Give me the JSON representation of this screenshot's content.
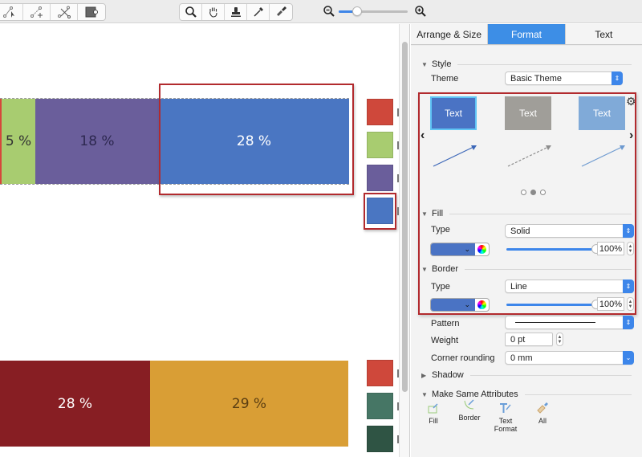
{
  "toolbar": {
    "left_tools": [
      {
        "icon": "select-path-icon",
        "label": "Select path"
      },
      {
        "icon": "add-point-icon",
        "label": "Add point"
      },
      {
        "icon": "scissors-path-icon",
        "label": "Cut path"
      },
      {
        "icon": "insert-shape-icon",
        "label": "Insert shape"
      }
    ],
    "center_tools": [
      {
        "icon": "magnifier-icon",
        "label": "Zoom"
      },
      {
        "icon": "hand-icon",
        "label": "Pan"
      },
      {
        "icon": "stamp-icon",
        "label": "Stamp"
      },
      {
        "icon": "eyedropper-icon",
        "label": "Eyedropper"
      },
      {
        "icon": "paint-brush-icon",
        "label": "Format painter"
      }
    ],
    "zoom_level_fraction": 0.27
  },
  "canvas": {
    "row1": [
      {
        "label": "",
        "color": "#d6473b",
        "share": 0.5
      },
      {
        "label": "5 %",
        "color": "#a8cc70",
        "share": 5,
        "text_color": "#333"
      },
      {
        "label": "18 %",
        "color": "#6a5e9b",
        "share": 18,
        "text_color": "#2d2850"
      },
      {
        "label": "28 %",
        "color": "#4a76c2",
        "share": 28,
        "text_color": "#ffffff"
      }
    ],
    "row2": [
      {
        "label": "28 %",
        "color": "#871e23",
        "share": 28,
        "text_color": "#ffffff"
      },
      {
        "label": "29 %",
        "color": "#d99e35",
        "share": 29,
        "text_color": "#5b3e12"
      }
    ],
    "legend_top": [
      "#cf483b",
      "#a8cc70",
      "#6a5e9b",
      "#4a76c2"
    ],
    "legend_bottom": [
      "#cf483b",
      "#467665",
      "#2f5444"
    ]
  },
  "inspector": {
    "tabs": [
      {
        "label": "Arrange & Size",
        "active": false
      },
      {
        "label": "Format",
        "active": true
      },
      {
        "label": "Text",
        "active": false
      }
    ],
    "style": {
      "header": "Style",
      "theme_label": "Theme",
      "theme_value": "Basic Theme"
    },
    "gallery": {
      "cards": [
        {
          "label": "Text",
          "color": "#4a73c4",
          "selected": true,
          "line_color": "#3c67b8",
          "dashed": false
        },
        {
          "label": "Text",
          "color": "#a09e99",
          "selected": false,
          "line_color": "#8d8d8d",
          "dashed": true
        },
        {
          "label": "Text",
          "color": "#80aad8",
          "selected": false,
          "line_color": "#6d9ad0",
          "dashed": false
        }
      ],
      "page_dots": [
        false,
        true,
        false
      ]
    },
    "fill": {
      "header": "Fill",
      "type_label": "Type",
      "type_value": "Solid",
      "color": "#4a73c4",
      "opacity": "100%"
    },
    "border": {
      "header": "Border",
      "type_label": "Type",
      "type_value": "Line",
      "color": "#4a73c4",
      "opacity": "100%",
      "pattern_label": "Pattern",
      "weight_label": "Weight",
      "weight_value": "0 pt",
      "corner_label": "Corner rounding",
      "corner_value": "0 mm"
    },
    "shadow": {
      "header": "Shadow"
    },
    "make_same": {
      "header": "Make Same Attributes",
      "buttons": [
        {
          "label": "Fill",
          "icon": "fill-dropper-icon"
        },
        {
          "label": "Border",
          "icon": "border-dropper-icon"
        },
        {
          "label": "Text Format",
          "icon": "text-format-icon"
        },
        {
          "label": "All",
          "icon": "brush-all-icon"
        }
      ]
    }
  }
}
